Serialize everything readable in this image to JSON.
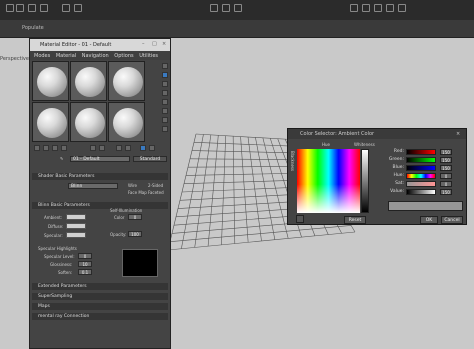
{
  "app": {
    "ribbon_label": "Populate",
    "viewport_label": "Perspective | Default Shading"
  },
  "material_editor": {
    "title": "Material Editor - 01 - Default",
    "menu": [
      "Modes",
      "Material",
      "Navigation",
      "Options",
      "Utilities"
    ],
    "material_name": "01 - Default",
    "material_type": "Standard",
    "rollouts": {
      "shader_basic": "Shader Basic Parameters",
      "blinn_basic": "Blinn Basic Parameters",
      "extended": "Extended Parameters",
      "supersampling": "SuperSampling",
      "maps": "Maps",
      "mental_ray": "mental ray Connection"
    },
    "shader_type": "Blinn",
    "shader_options": [
      "Wire",
      "2-Sided",
      "Face Map",
      "Faceted"
    ],
    "labels": {
      "ambient": "Ambient:",
      "diffuse": "Diffuse:",
      "specular": "Specular:",
      "self_illum": "Self-Illumination",
      "color": "Color",
      "opacity": "Opacity:",
      "spec_highlights": "Specular Highlights",
      "spec_level": "Specular Level:",
      "glossiness": "Glossiness:",
      "soften": "Soften:"
    },
    "values": {
      "self_illum_color": "0",
      "opacity": "100",
      "spec_level": "0",
      "glossiness": "10",
      "soften": "0.1"
    }
  },
  "color_selector": {
    "title": "Color Selector: Ambient Color",
    "hue_label": "Hue",
    "whiteness_label": "Whiteness",
    "blackness_label": "Blackness",
    "rows": [
      {
        "label": "Red:",
        "value": "150",
        "color": "#ff4040"
      },
      {
        "label": "Green:",
        "value": "150",
        "color": "#40ff40"
      },
      {
        "label": "Blue:",
        "value": "150",
        "color": "#4040ff"
      },
      {
        "label": "Hue:",
        "value": "0",
        "color": "#ff00ff"
      },
      {
        "label": "Sat:",
        "value": "0",
        "color": "#888888"
      },
      {
        "label": "Value:",
        "value": "150",
        "color": "#e0e0e0"
      }
    ],
    "reset_label": "Reset",
    "ok_label": "OK",
    "cancel_label": "Cancel",
    "swatch_color": "#969696"
  }
}
